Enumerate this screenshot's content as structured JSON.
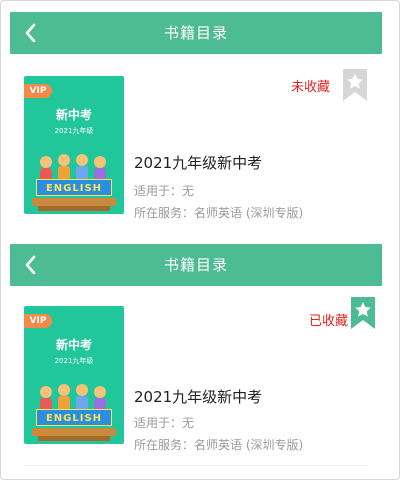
{
  "screens": [
    {
      "header": {
        "title": "书籍目录",
        "back_icon": "chevron-left-icon"
      },
      "book": {
        "cover_badge": "VIP",
        "cover_title": "新中考",
        "cover_subtitle": "2021九年级",
        "cover_banner": "ENGLISH",
        "title": "2021九年级新中考",
        "applicable": "适用于：无",
        "service": "所在服务：名师英语 (深圳专版)",
        "status": "未收藏",
        "bookmark_icon": "bookmark-star-icon",
        "bookmark_color": "#d6d6d6"
      }
    },
    {
      "header": {
        "title": "书籍目录",
        "back_icon": "chevron-left-icon"
      },
      "book": {
        "cover_badge": "VIP",
        "cover_title": "新中考",
        "cover_subtitle": "2021九年级",
        "cover_banner": "ENGLISH",
        "title": "2021九年级新中考",
        "applicable": "适用于：无",
        "service": "所在服务：名师英语 (深圳专版)",
        "status": "已收藏",
        "bookmark_icon": "bookmark-star-icon",
        "bookmark_color": "#4dbb94"
      }
    }
  ],
  "colors": {
    "header": "#4dbb94",
    "status_text": "#e02424",
    "cover": "#21c79a"
  }
}
